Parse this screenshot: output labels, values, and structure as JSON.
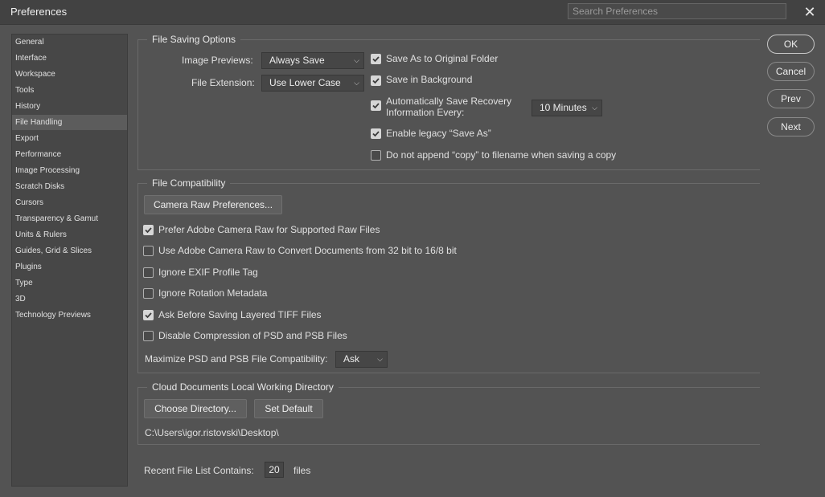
{
  "window": {
    "title": "Preferences"
  },
  "search": {
    "placeholder": "Search Preferences"
  },
  "sidebar": {
    "items": [
      {
        "label": "General"
      },
      {
        "label": "Interface"
      },
      {
        "label": "Workspace"
      },
      {
        "label": "Tools"
      },
      {
        "label": "History"
      },
      {
        "label": "File Handling",
        "active": true
      },
      {
        "label": "Export"
      },
      {
        "label": "Performance"
      },
      {
        "label": "Image Processing"
      },
      {
        "label": "Scratch Disks"
      },
      {
        "label": "Cursors"
      },
      {
        "label": "Transparency & Gamut"
      },
      {
        "label": "Units & Rulers"
      },
      {
        "label": "Guides, Grid & Slices"
      },
      {
        "label": "Plugins"
      },
      {
        "label": "Type"
      },
      {
        "label": "3D"
      },
      {
        "label": "Technology Previews"
      }
    ]
  },
  "file_saving": {
    "legend": "File Saving Options",
    "image_previews_label": "Image Previews:",
    "image_previews_value": "Always Save",
    "file_extension_label": "File Extension:",
    "file_extension_value": "Use Lower Case",
    "save_original_folder": {
      "label": "Save As to Original Folder",
      "checked": true
    },
    "save_background": {
      "label": "Save in Background",
      "checked": true
    },
    "auto_save_line1": "Automatically Save Recovery",
    "auto_save_line2": "Information Every:",
    "auto_save_checked": true,
    "auto_save_interval": "10 Minutes",
    "legacy_save_as": {
      "label": "Enable legacy “Save As”",
      "checked": true
    },
    "no_append_copy": {
      "label": "Do not append “copy” to filename when saving a copy",
      "checked": false
    }
  },
  "file_compat": {
    "legend": "File Compatibility",
    "camera_raw_button": "Camera Raw Preferences...",
    "options": [
      {
        "label": "Prefer Adobe Camera Raw for Supported Raw Files",
        "checked": true
      },
      {
        "label": "Use Adobe Camera Raw to Convert Documents from 32 bit to 16/8 bit",
        "checked": false
      },
      {
        "label": "Ignore EXIF Profile Tag",
        "checked": false
      },
      {
        "label": "Ignore Rotation Metadata",
        "checked": false
      },
      {
        "label": "Ask Before Saving Layered TIFF Files",
        "checked": true
      },
      {
        "label": "Disable Compression of PSD and PSB Files",
        "checked": false
      }
    ],
    "maximize_label": "Maximize PSD and PSB File Compatibility:",
    "maximize_value": "Ask"
  },
  "cloud": {
    "legend": "Cloud Documents Local Working Directory",
    "choose_button": "Choose Directory...",
    "default_button": "Set Default",
    "path": "C:\\Users\\igor.ristovski\\Desktop\\"
  },
  "recent": {
    "label": "Recent File List Contains:",
    "value": "20",
    "suffix": "files"
  },
  "buttons": {
    "ok": "OK",
    "cancel": "Cancel",
    "prev": "Prev",
    "next": "Next"
  }
}
